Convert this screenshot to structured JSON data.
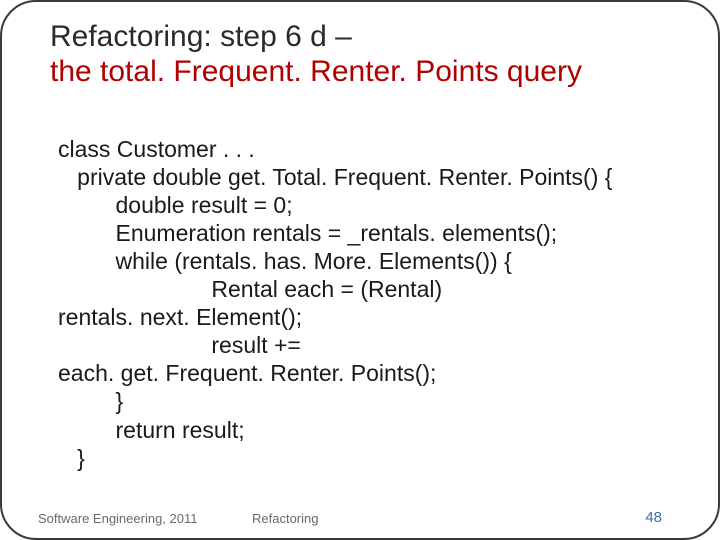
{
  "title": {
    "line1": "Refactoring: step 6 d –",
    "line2": " the total. Frequent. Renter. Points query"
  },
  "code": {
    "l0": "class Customer . . .",
    "l1": "   private double get. Total. Frequent. Renter. Points() {",
    "l2": "         double result = 0;",
    "l3": "         Enumeration rentals = _rentals. elements();",
    "l4": "         while (rentals. has. More. Elements()) {",
    "l5": "                        Rental each = (Rental)",
    "l6": "rentals. next. Element();",
    "l7": "                        result +=",
    "l8": "each. get. Frequent. Renter. Points();",
    "l9": "         }",
    "l10": "         return result;",
    "l11": "   }"
  },
  "footer": {
    "left": "Software Engineering, 2011",
    "mid": "Refactoring",
    "page": "48"
  }
}
